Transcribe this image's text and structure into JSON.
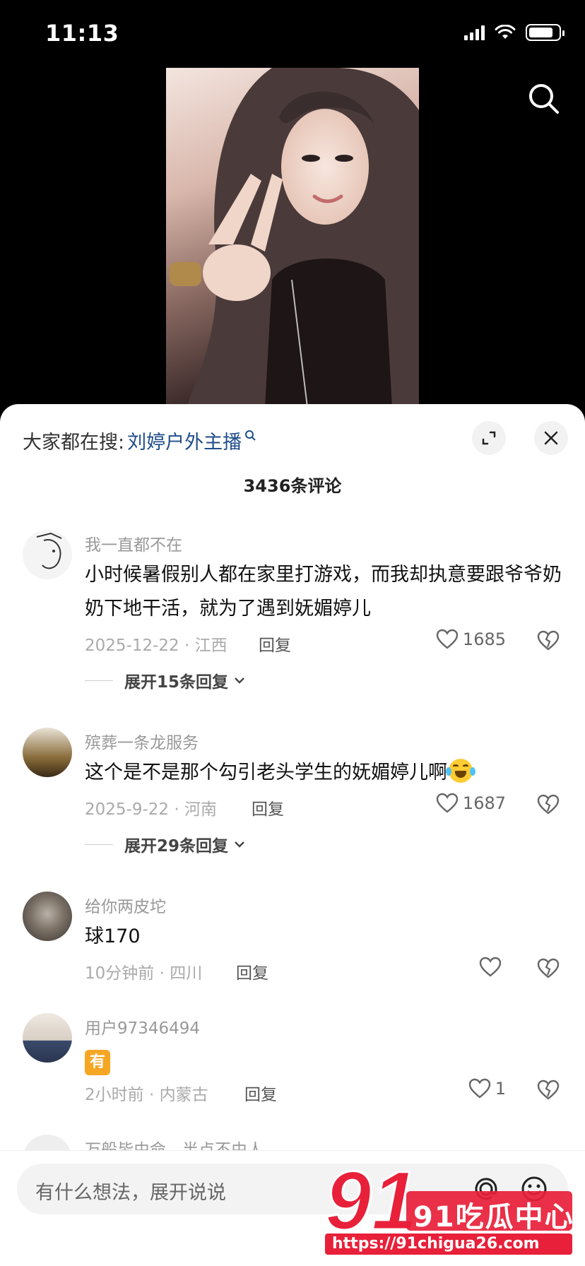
{
  "status_bar": {
    "time": "11:13"
  },
  "sheet": {
    "hot_search_prefix": "大家都在搜:",
    "hot_search_term": "刘婷户外主播",
    "comment_count": "3436条评论"
  },
  "comments": [
    {
      "user": "我一直都不在",
      "text": "小时候暑假别人都在家里打游戏，而我却执意要跟爷爷奶奶下地干活，就为了遇到妩媚婷儿",
      "meta": "2025-12-22 · 江西",
      "reply": "回复",
      "likes": "1685",
      "expand": "展开15条回复"
    },
    {
      "user": "殡葬一条龙服务",
      "text": "这个是不是那个勾引老头学生的妩媚婷儿啊",
      "meta": "2025-9-22 · 河南",
      "reply": "回复",
      "likes": "1687",
      "expand": "展开29条回复"
    },
    {
      "user": "给你两皮坨",
      "text": "球170",
      "meta": "10分钟前 · 四川",
      "reply": "回复",
      "likes": ""
    },
    {
      "user": "用户97346494",
      "emoji": "有",
      "meta": "2小时前 · 内蒙古",
      "reply": "回复",
      "likes": "1"
    }
  ],
  "partial_comment_user": "万般皆由命，半点不由人",
  "input": {
    "placeholder": "有什么想法，展开说说"
  },
  "watermark": {
    "logo": "91吃瓜中心",
    "url": "https://91chigua26.com"
  },
  "colors": {
    "accent_link": "#1f4d8a",
    "watermark": "#e8203a"
  },
  "icons": [
    "search-icon",
    "expand-icon",
    "close-icon",
    "heart-icon",
    "broken-heart-icon",
    "at-icon",
    "emoji-icon"
  ]
}
